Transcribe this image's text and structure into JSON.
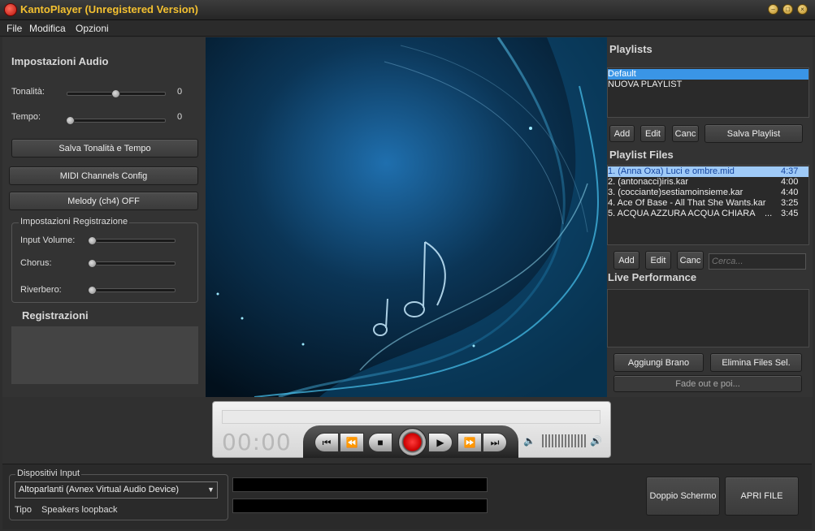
{
  "window": {
    "title": "KantoPlayer (Unregistered Version)"
  },
  "menu": [
    "File",
    "Modifica",
    "Opzioni"
  ],
  "audio": {
    "heading": "Impostazioni Audio",
    "tonalita_label": "Tonalità:",
    "tonalita_value": "0",
    "tempo_label": "Tempo:",
    "tempo_value": "0",
    "save_button": "Salva Tonalità e Tempo",
    "midi_button": "MIDI Channels Config",
    "melody_button": "Melody (ch4) OFF"
  },
  "recording": {
    "group_title": "Impostazioni Registrazione",
    "input_volume": "Input Volume:",
    "chorus": "Chorus:",
    "riverbero": "Riverbero:",
    "registrazioni": "Registrazioni"
  },
  "playlists": {
    "heading": "Playlists",
    "items": [
      "Default",
      "NUOVA PLAYLIST"
    ],
    "add": "Add",
    "edit": "Edit",
    "canc": "Canc",
    "save": "Salva Playlist"
  },
  "playlist_files": {
    "heading": "Playlist Files",
    "items": [
      {
        "name": "1. (Anna Oxa) Luci e ombre.mid",
        "duration": "4:37"
      },
      {
        "name": "2. (antonacci)iris.kar",
        "duration": "4:00"
      },
      {
        "name": "3. (cocciante)sestiamoinsieme.kar",
        "duration": "4:40"
      },
      {
        "name": "4. Ace Of Base - All That She Wants.kar",
        "duration": "3:25"
      },
      {
        "name": "5. ACQUA AZZURA ACQUA CHIARA",
        "duration": "3:45"
      }
    ],
    "ellipsis": "...",
    "add": "Add",
    "edit": "Edit",
    "canc": "Canc",
    "search_placeholder": "Cerca..."
  },
  "live": {
    "heading": "Live Performance",
    "add_button": "Aggiungi Brano",
    "remove_button": "Elimina Files Sel.",
    "fade_button": "Fade out e poi..."
  },
  "player": {
    "time": "00:00"
  },
  "input_devices": {
    "group_title": "Dispositivi Input",
    "selected": "Altoparlanti (Avnex Virtual Audio Device)",
    "tipo_label": "Tipo",
    "tipo_value": "Speakers loopback"
  },
  "bottom": {
    "dual_screen": "Doppio Schermo",
    "open_file": "APRI FILE"
  },
  "colors": {
    "title": "#f3c030",
    "selection": "#3a95e6",
    "record": "#e01010"
  }
}
